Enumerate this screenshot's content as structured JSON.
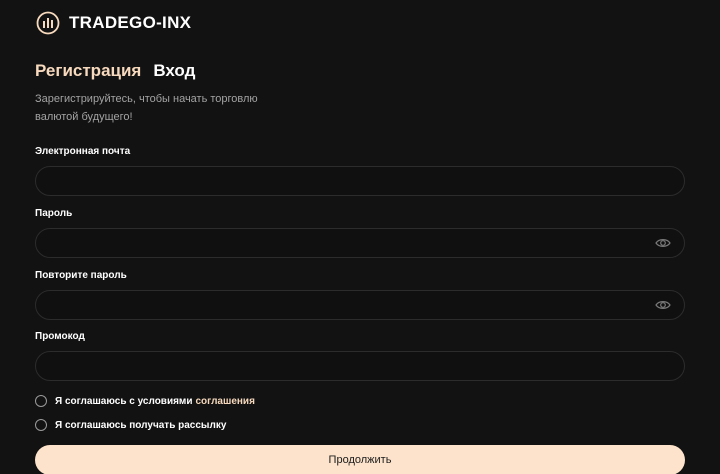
{
  "brand": {
    "name": "TRADEGO-INX",
    "icon": "chart-bars-icon"
  },
  "tabs": [
    {
      "label": "Регистрация",
      "active": true
    },
    {
      "label": "Вход",
      "active": false
    }
  ],
  "subtitle": "Зарегистрируйтесь, чтобы начать торговлю валютой будущего!",
  "form": {
    "email": {
      "label": "Электронная почта",
      "value": ""
    },
    "password": {
      "label": "Пароль",
      "value": "",
      "toggle_icon": "eye-icon"
    },
    "password_repeat": {
      "label": "Повторите пароль",
      "value": "",
      "toggle_icon": "eye-icon"
    },
    "promo": {
      "label": "Промокод",
      "value": ""
    }
  },
  "agreements": {
    "terms_text": "Я соглашаюсь с условиями",
    "terms_link": "соглашения",
    "newsletter_text": "Я соглашаюсь получать рассылку"
  },
  "submit_label": "Продолжить",
  "colors": {
    "accent": "#f7d9bd",
    "button": "#fde3cb",
    "background": "#121212"
  }
}
